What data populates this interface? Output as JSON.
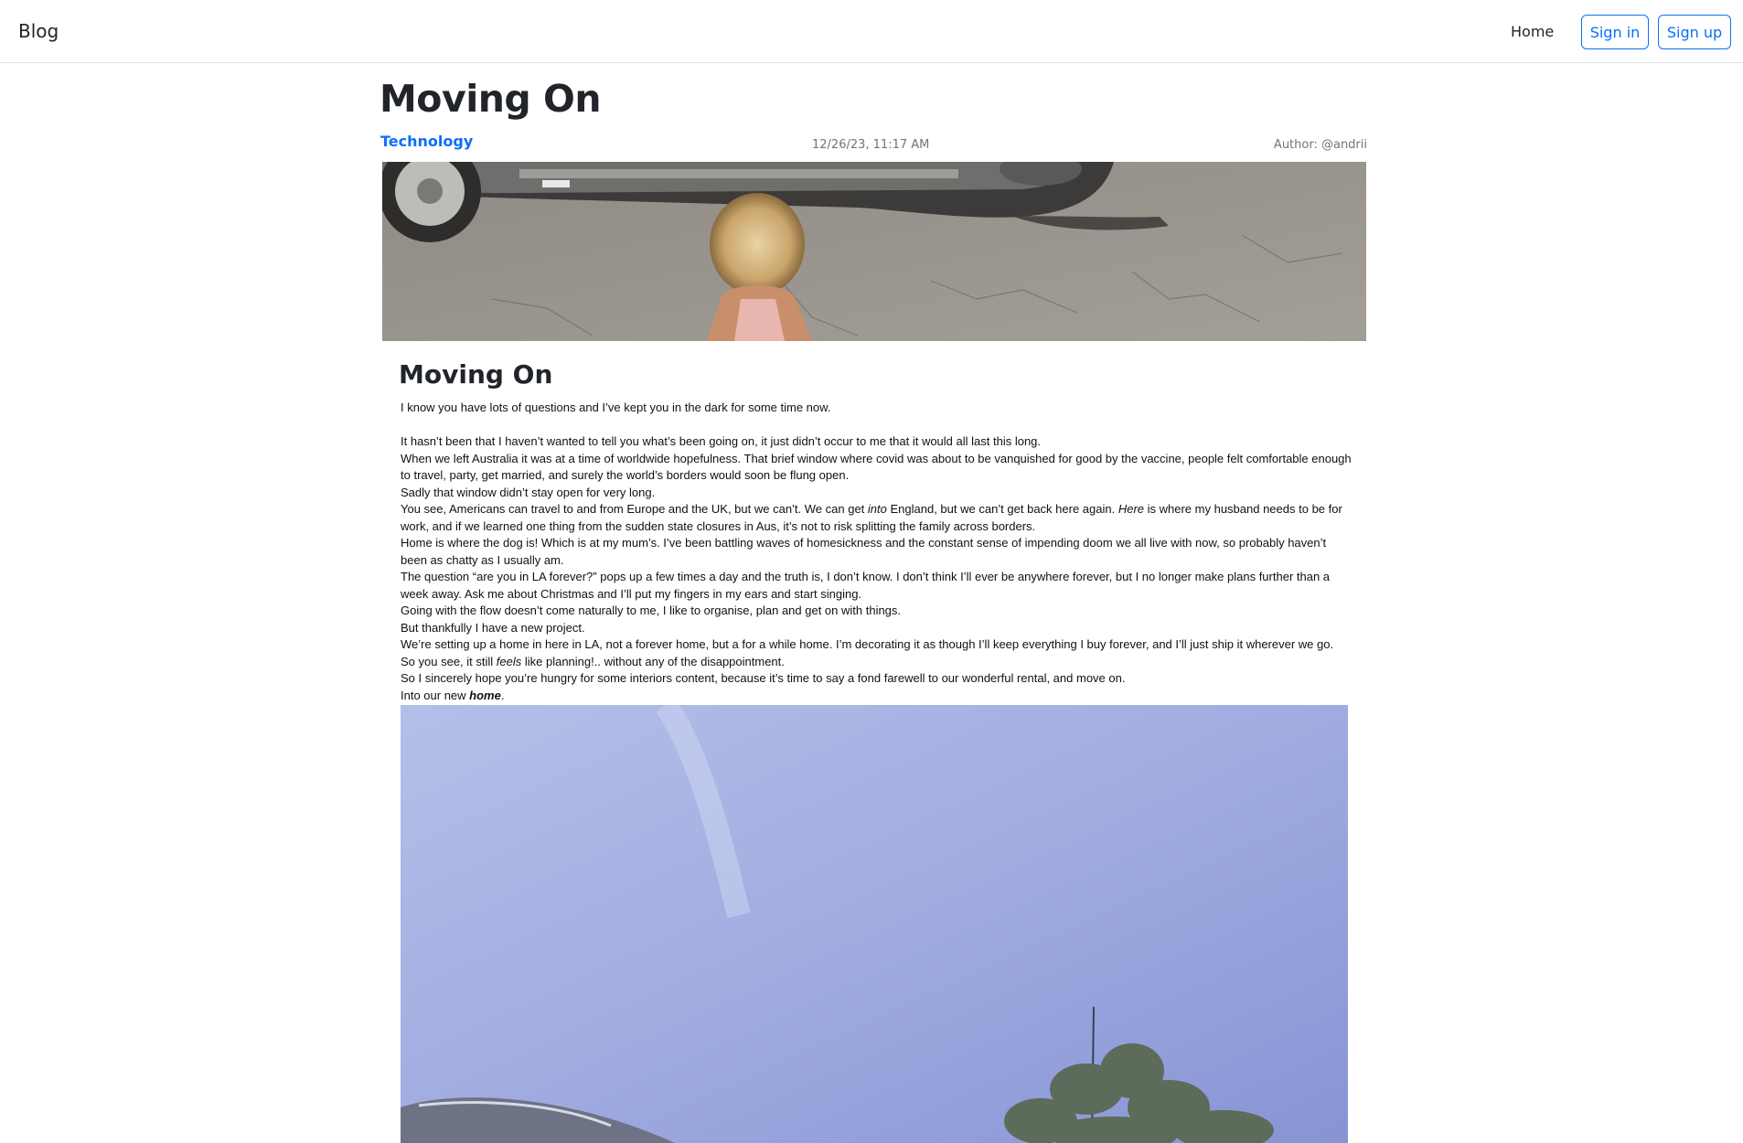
{
  "navbar": {
    "brand": "Blog",
    "home_label": "Home",
    "signin_label": "Sign in",
    "signup_label": "Sign up"
  },
  "post": {
    "title": "Moving On",
    "category": "Technology",
    "date": "12/26/23, 11:17 AM",
    "author": "Author: @andrii"
  },
  "article": {
    "heading": "Moving On",
    "p1": "I know you have lots of questions and I’ve kept you in the dark for some time now.",
    "p2": "It hasn’t been that I haven’t wanted to tell you what’s been going on, it just didn’t occur to me that it would all last this long.",
    "p3": "When we left Australia it was at a time of worldwide hopefulness. That brief window where covid was about to be vanquished for good by the vaccine, people felt comfortable enough to travel, party, get married, and surely the world’s borders would soon be flung open.",
    "p4": "Sadly that window didn’t stay open for very long.",
    "p5a": "You see, Americans can travel to and from Europe and the UK, but we can’t. We can get ",
    "p5b": "into",
    "p5c": " England, but we can’t get back here again. ",
    "p5d": "Here",
    "p5e": " is where my husband needs to be for work, and if we learned one thing from the sudden state closures in Aus, it’s not to risk splitting the family across borders.",
    "p6": "Home is where the dog is! Which is at my mum’s. I’ve been battling waves of homesickness and the constant sense of impending doom we all live with now, so probably haven’t been as chatty as I usually am.",
    "p7": "The question “are you in LA forever?” pops up a few times a day and the truth is, I don’t know. I don’t think I’ll ever be anywhere forever, but I no longer make plans further than a week away. Ask me about Christmas and I’ll put my fingers in my ears and start singing.",
    "p8": "Going with the flow doesn’t come naturally to me, I like to organise, plan and get on with things.",
    "p9": "But thankfully I have a new project.",
    "p10": "We’re setting up a home in here in LA, not a forever home, but a for a while home. I’m decorating it as though I’ll keep everything I buy forever, and I’ll just ship it wherever we go.",
    "p11a": "So you see, it still ",
    "p11b": "feels",
    "p11c": " like planning!.. without any of the disappointment.",
    "p12": "So I sincerely hope you’re hungry for some interiors content, because it’s time to say a fond farewell to our wonderful rental, and move on.",
    "p13a": "Into our new ",
    "p13b": "home",
    "p13c": "."
  }
}
